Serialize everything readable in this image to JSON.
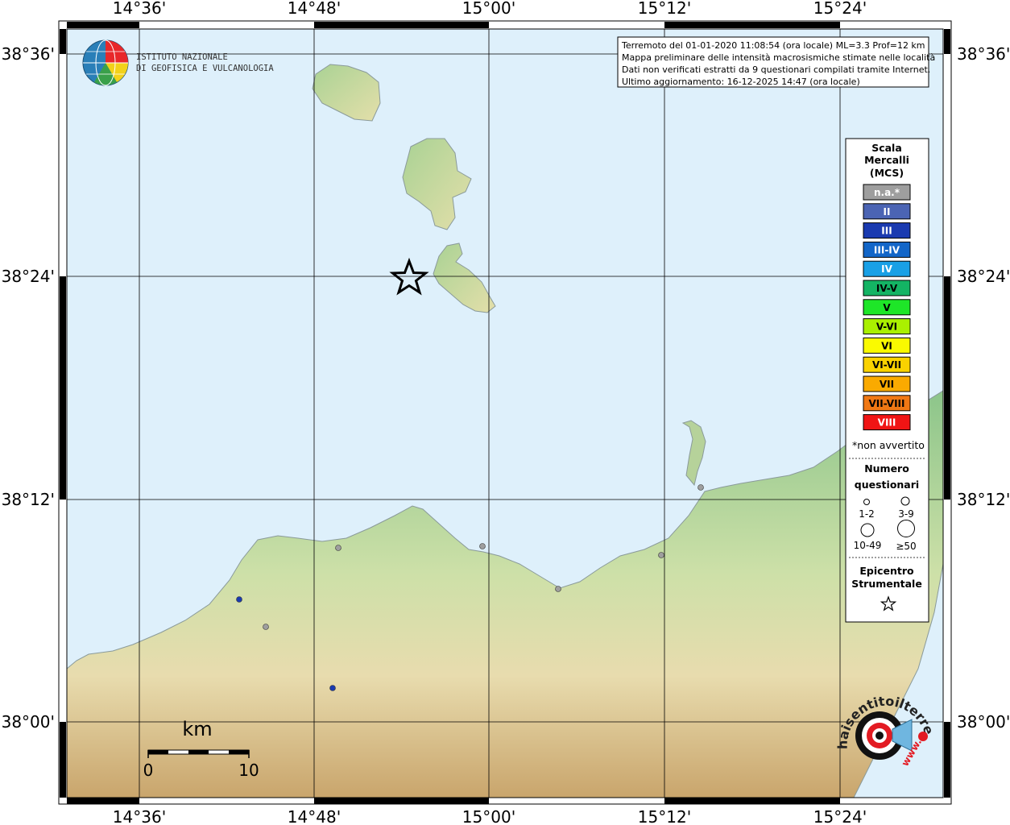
{
  "title_box": {
    "line1": "Terremoto del 01-01-2020 11:08:54 (ora locale) ML=3.3 Prof=12 km",
    "line2": "Mappa preliminare delle intensità macrosismiche stimate nelle località",
    "line3": "Dati non verificati estratti da 9 questionari compilati tramite Internet.",
    "line4": "Ultimo aggiornamento: 16-12-2025 14:47 (ora locale)"
  },
  "axes": {
    "lon_labels": [
      "14°36'",
      "14°48'",
      "15°00'",
      "15°12'",
      "15°24'"
    ],
    "lat_labels": [
      "38°36'",
      "38°24'",
      "38°12'",
      "38°00'"
    ]
  },
  "logo": {
    "line1": "ISTITUTO NAZIONALE",
    "line2": "DI GEOFISICA E VULCANOLOGIA"
  },
  "legend": {
    "title1": "Scala",
    "title2": "Mercalli",
    "title3": "(MCS)",
    "scale": [
      {
        "label": "n.a.*",
        "color": "#9e9e9e",
        "text_color": "#ffffff"
      },
      {
        "label": "II",
        "color": "#4b64b4",
        "text_color": "#ffffff"
      },
      {
        "label": "III",
        "color": "#1a3ab0",
        "text_color": "#ffffff"
      },
      {
        "label": "III-IV",
        "color": "#1366c8",
        "text_color": "#ffffff"
      },
      {
        "label": "IV",
        "color": "#19a0e6",
        "text_color": "#ffffff"
      },
      {
        "label": "IV-V",
        "color": "#14b464",
        "text_color": "#000000"
      },
      {
        "label": "V",
        "color": "#1ee628",
        "text_color": "#000000"
      },
      {
        "label": "V-VI",
        "color": "#aaf000",
        "text_color": "#000000"
      },
      {
        "label": "VI",
        "color": "#fafa00",
        "text_color": "#000000"
      },
      {
        "label": "VI-VII",
        "color": "#fad200",
        "text_color": "#000000"
      },
      {
        "label": "VII",
        "color": "#faaa00",
        "text_color": "#000000"
      },
      {
        "label": "VII-VIII",
        "color": "#f07814",
        "text_color": "#000000"
      },
      {
        "label": "VIII",
        "color": "#f01414",
        "text_color": "#ffffff"
      }
    ],
    "na_note": "*non avvertito",
    "num_title1": "Numero",
    "num_title2": "questionari",
    "num_ranges": [
      "1-2",
      "3-9",
      "10-49",
      "≥50"
    ],
    "epi_title1": "Epicentro",
    "epi_title2": "Strumentale"
  },
  "scalebar": {
    "unit": "km",
    "min": "0",
    "max": "10"
  },
  "watermark": {
    "text": "haisentitoilterremoto.it",
    "url": "www."
  },
  "colors": {
    "sea": "#def0fb",
    "land_low": "#7fbf7b",
    "land_mid": "#e6dcaa",
    "land_high": "#c8a064",
    "grid": "#000000"
  },
  "observations": [
    {
      "intensity": "II",
      "questionnaires": "1-2"
    },
    {
      "intensity": "II",
      "questionnaires": "1-2"
    },
    {
      "intensity": "n.a.*",
      "questionnaires": "1-2"
    },
    {
      "intensity": "n.a.*",
      "questionnaires": "1-2"
    },
    {
      "intensity": "n.a.*",
      "questionnaires": "1-2"
    },
    {
      "intensity": "n.a.*",
      "questionnaires": "1-2"
    },
    {
      "intensity": "n.a.*",
      "questionnaires": "1-2"
    },
    {
      "intensity": "n.a.*",
      "questionnaires": "1-2"
    }
  ]
}
